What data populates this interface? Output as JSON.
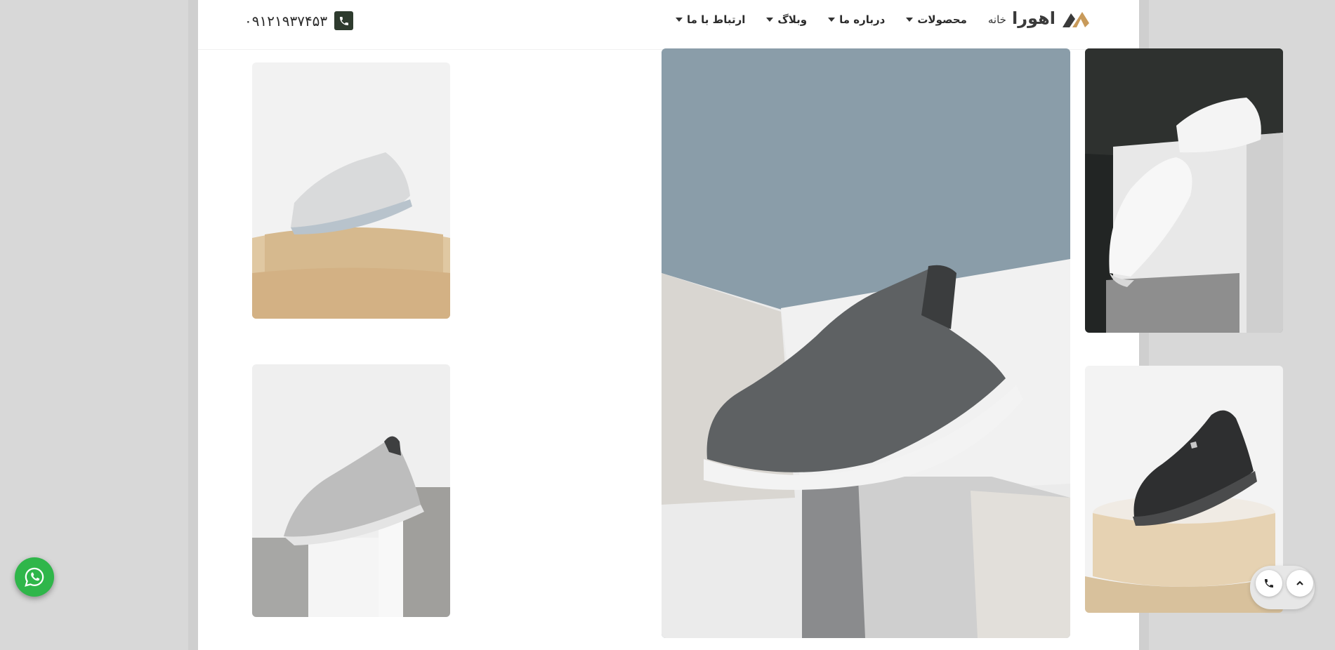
{
  "header": {
    "logo_text": "اهورا",
    "nav": {
      "home": "خانه",
      "products": "محصولات",
      "about": "درباره ما",
      "blog": "وبلاگ",
      "contact": "ارتباط با ما"
    },
    "phone_number": "۰۹۱۲۱۹۳۷۴۵۳"
  },
  "colors": {
    "brand_accent": "#c89a5a",
    "phone_icon_bg": "#2e3b2e",
    "whatsapp": "#2fb64a",
    "hero_sky": "#8a9da9"
  },
  "icons": {
    "phone": "phone-icon",
    "whatsapp": "whatsapp-icon",
    "call": "call-icon",
    "scroll_top": "chevron-up-icon"
  },
  "gallery": [
    "shoe-white-on-wood-pedestal",
    "shoe-white-on-cube",
    "shoe-dark-grey-hero",
    "shoe-grey-runner-on-blocks",
    "shoe-black-sport-on-round-pedestal"
  ]
}
